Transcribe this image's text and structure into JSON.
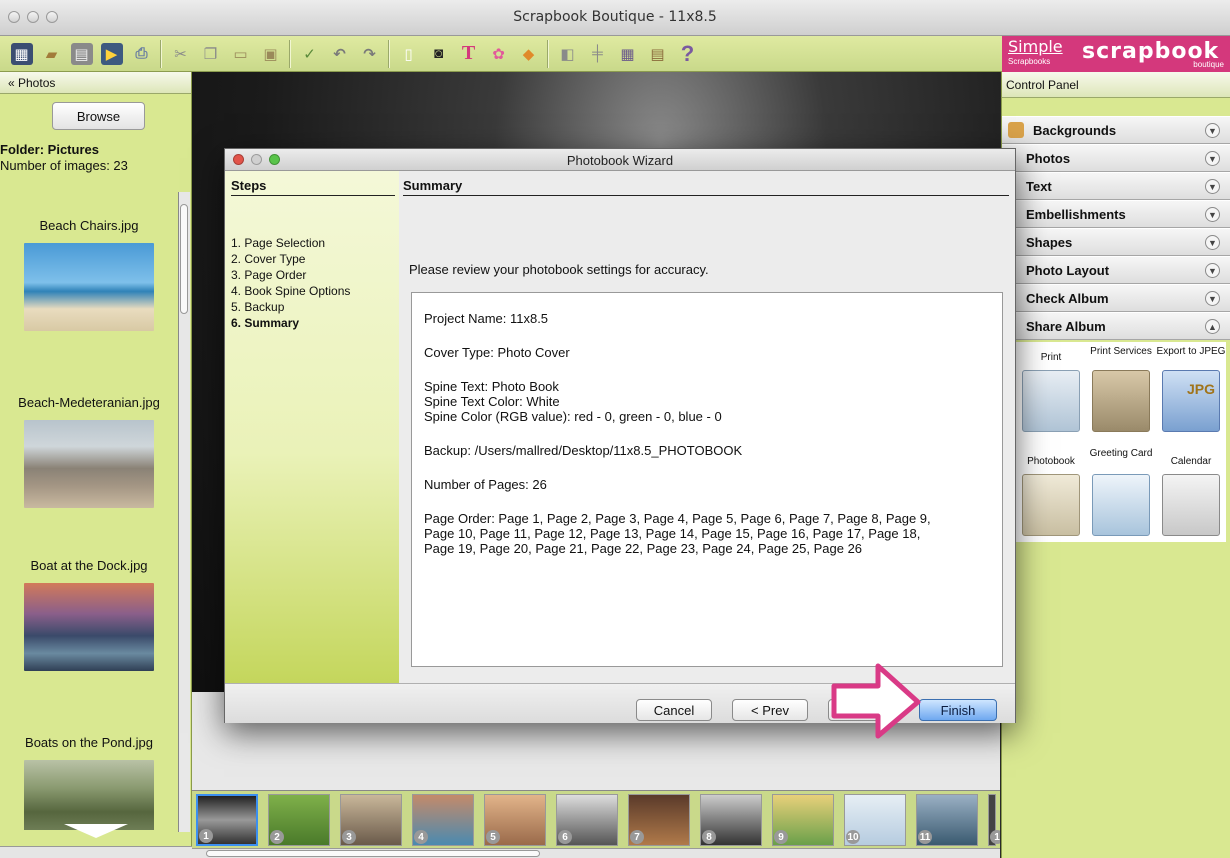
{
  "window": {
    "title": "Scrapbook Boutique - 11x8.5"
  },
  "brand": {
    "simple": "Simple",
    "simple_sub": "Scrapbooks",
    "scrapbook": "scrapbook",
    "boutique": "boutique"
  },
  "toolbar": {
    "tools": [
      "new-project",
      "open",
      "save",
      "export",
      "print",
      "cut",
      "copy",
      "paste",
      "paste-special",
      "spell-check",
      "undo",
      "redo",
      "new-page",
      "camera",
      "text",
      "flower",
      "embellish",
      "layer-back",
      "align",
      "grid",
      "film",
      "help"
    ]
  },
  "left_panel": {
    "header": "« Photos",
    "browse_label": "Browse",
    "folder_label": "Folder: Pictures",
    "count_label": "Number of images: 23",
    "photos": [
      {
        "name": "Beach Chairs.jpg",
        "color": "#3f8ec8"
      },
      {
        "name": "Beach-Medeteranian.jpg",
        "color": "#8a8c8e"
      },
      {
        "name": "Boat at the Dock.jpg",
        "color": "#6a5f78"
      },
      {
        "name": "Boats on the Pond.jpg",
        "color": "#6f7d52"
      }
    ]
  },
  "filmstrip": {
    "pages": [
      "1",
      "2",
      "3",
      "4",
      "5",
      "6",
      "7",
      "8",
      "9",
      "10",
      "11",
      "1"
    ]
  },
  "control_panel": {
    "header": "Control Panel",
    "sections": [
      "Backgrounds",
      "Photos",
      "Text",
      "Embellishments",
      "Shapes",
      "Photo Layout",
      "Check Album",
      "Share Album"
    ],
    "share_items": [
      "Print",
      "Print Services",
      "Export to JPEG",
      "Photobook",
      "Greeting Card",
      "Calendar"
    ],
    "share_icon_text": "JPG"
  },
  "dialog": {
    "title": "Photobook Wizard",
    "steps_header": "Steps",
    "steps": [
      "1. Page Selection",
      "2. Cover Type",
      "3. Page Order",
      "4. Book Spine Options",
      "5. Backup",
      "6. Summary"
    ],
    "current_step": 5,
    "summary_header": "Summary",
    "intro": "Please review your photobook settings for accuracy.",
    "project_name": "Project Name: 11x8.5",
    "cover_type": "Cover Type: Photo Cover",
    "spine_text": "Spine Text: Photo Book",
    "spine_text_color": "Spine Text Color: White",
    "spine_color": "Spine Color (RGB value): red - 0, green - 0, blue - 0",
    "backup": "Backup: /Users/mallred/Desktop/11x8.5_PHOTOBOOK",
    "num_pages": "Number of Pages: 26",
    "page_order_1": "Page Order: Page 1, Page 2, Page 3, Page 4, Page 5, Page 6, Page 7, Page 8, Page 9,",
    "page_order_2": "Page 10, Page 11, Page 12, Page 13, Page 14, Page 15, Page 16, Page 17, Page 18,",
    "page_order_3": "Page 19, Page 20, Page 21, Page 22, Page 23, Page 24, Page 25, Page 26",
    "cancel_label": "Cancel",
    "prev_label": "< Prev",
    "finish_label": "Finish"
  },
  "colors": {
    "accent_green": "#d9e891",
    "brand_pink": "#d4387c",
    "callout_pink": "#d93a86"
  }
}
